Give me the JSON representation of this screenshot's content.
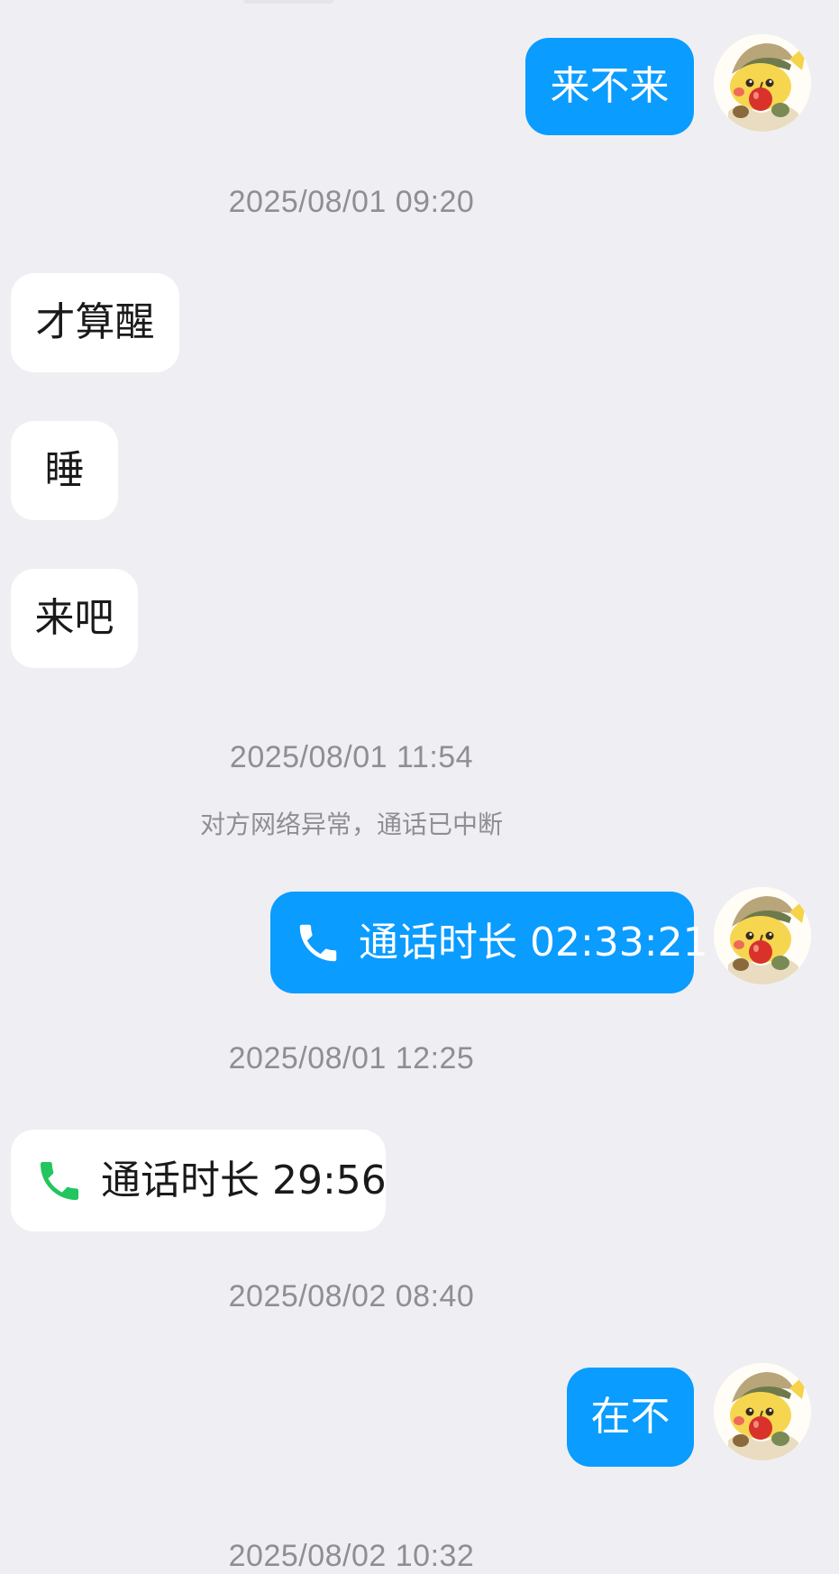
{
  "messages": {
    "m1": "来不来",
    "t1": "2025/08/01 09:20",
    "m2": "才算醒",
    "m3": "睡",
    "m4": "来吧",
    "t2": "2025/08/01 11:54",
    "sys1": "对方网络异常，通话已中断",
    "call1": "通话时长 02:33:21",
    "t3": "2025/08/01 12:25",
    "call2": "通话时长 29:56",
    "t4": "2025/08/02 08:40",
    "m5": "在不",
    "t5": "2025/08/02 10:32"
  },
  "colors": {
    "background": "#efeff3",
    "outgoing_bubble": "#0a9cff",
    "incoming_bubble": "#ffffff",
    "call_icon_outgoing": "#ffffff",
    "call_icon_incoming": "#22c55e",
    "timestamp_text": "#8e8e93"
  },
  "icons": {
    "call_outgoing": "phone-icon",
    "call_incoming": "phone-icon",
    "avatar": "pikachu-sticker-avatar"
  }
}
